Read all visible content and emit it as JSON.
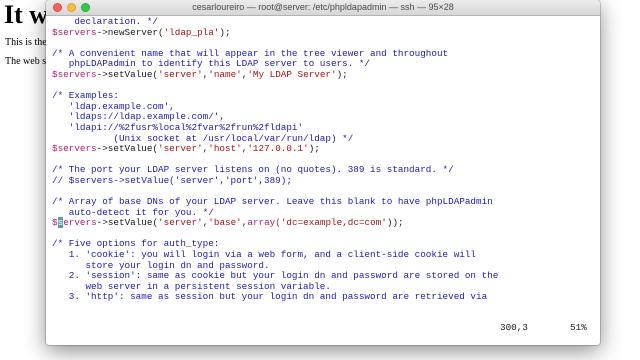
{
  "background_page": {
    "heading": "It wo",
    "paragraph_1": "This is the",
    "paragraph_2": "The web se"
  },
  "window": {
    "title": "cesarloureiro — root@server: /etc/phpldapadmin — ssh — 95×28"
  },
  "colors": {
    "comment": "#1c1ca8",
    "variable": "#b21e6e",
    "string": "#a31515",
    "cursor": "#5f9ea0"
  },
  "lines": [
    [
      {
        "t": "    declaration. */",
        "c": "cm"
      }
    ],
    [
      {
        "t": "$servers",
        "c": "var"
      },
      {
        "t": "->newServer(",
        "c": "plain"
      },
      {
        "t": "'ldap_pla'",
        "c": "str"
      },
      {
        "t": ");",
        "c": "plain"
      }
    ],
    [],
    [
      {
        "t": "/* A convenient name that will appear in the tree viewer and throughout",
        "c": "cm"
      }
    ],
    [
      {
        "t": "   phpLDAPadmin to identify this LDAP server to users. */",
        "c": "cm"
      }
    ],
    [
      {
        "t": "$servers",
        "c": "var"
      },
      {
        "t": "->setValue(",
        "c": "plain"
      },
      {
        "t": "'server'",
        "c": "str"
      },
      {
        "t": ",",
        "c": "plain"
      },
      {
        "t": "'name'",
        "c": "str"
      },
      {
        "t": ",",
        "c": "plain"
      },
      {
        "t": "'My LDAP Server'",
        "c": "str"
      },
      {
        "t": ");",
        "c": "plain"
      }
    ],
    [],
    [
      {
        "t": "/* Examples:",
        "c": "cm"
      }
    ],
    [
      {
        "t": "   'ldap.example.com',",
        "c": "cm"
      }
    ],
    [
      {
        "t": "   'ldaps://ldap.example.com/',",
        "c": "cm"
      }
    ],
    [
      {
        "t": "   'ldapi://%2fusr%local%2fvar%2frun%2fldapi'",
        "c": "cm"
      }
    ],
    [
      {
        "t": "           (Unix socket at /usr/local/var/run/ldap) */",
        "c": "cm"
      }
    ],
    [
      {
        "t": "$servers",
        "c": "var"
      },
      {
        "t": "->setValue(",
        "c": "plain"
      },
      {
        "t": "'server'",
        "c": "str"
      },
      {
        "t": ",",
        "c": "plain"
      },
      {
        "t": "'host'",
        "c": "str"
      },
      {
        "t": ",",
        "c": "plain"
      },
      {
        "t": "'127.0.0.1'",
        "c": "str"
      },
      {
        "t": ");",
        "c": "plain"
      }
    ],
    [],
    [
      {
        "t": "/* The port your LDAP server listens on (no quotes). 389 is standard. */",
        "c": "cm"
      }
    ],
    [
      {
        "t": "// $servers->setValue('server','port',389);",
        "c": "cm"
      }
    ],
    [],
    [
      {
        "t": "/* Array of base DNs of your LDAP server. Leave this blank to have phpLDAPadmin",
        "c": "cm"
      }
    ],
    [
      {
        "t": "   auto-detect it for you. */",
        "c": "cm"
      }
    ],
    [
      {
        "t": "$",
        "c": "var"
      },
      {
        "t": "s",
        "c": "cursor"
      },
      {
        "t": "ervers",
        "c": "var"
      },
      {
        "t": "->setValue(",
        "c": "plain"
      },
      {
        "t": "'server'",
        "c": "str"
      },
      {
        "t": ",",
        "c": "plain"
      },
      {
        "t": "'base'",
        "c": "str"
      },
      {
        "t": ",",
        "c": "plain"
      },
      {
        "t": "array(",
        "c": "var"
      },
      {
        "t": "'dc=example,dc=com'",
        "c": "str"
      },
      {
        "t": "));",
        "c": "plain"
      }
    ],
    [],
    [
      {
        "t": "/* Five options for auth_type:",
        "c": "cm"
      }
    ],
    [
      {
        "t": "   1. 'cookie': you will login via a web form, and a client-side cookie will",
        "c": "cm"
      }
    ],
    [
      {
        "t": "      store your login dn and password.",
        "c": "cm"
      }
    ],
    [
      {
        "t": "   2. 'session': same as cookie but your login dn and password are stored on the",
        "c": "cm"
      }
    ],
    [
      {
        "t": "      web server in a persistent session variable.",
        "c": "cm"
      }
    ],
    [
      {
        "t": "   3. 'http': same as session but your login dn and password are retrieved via",
        "c": "cm"
      }
    ]
  ],
  "status": {
    "position": "300,3",
    "percent": "51%"
  }
}
